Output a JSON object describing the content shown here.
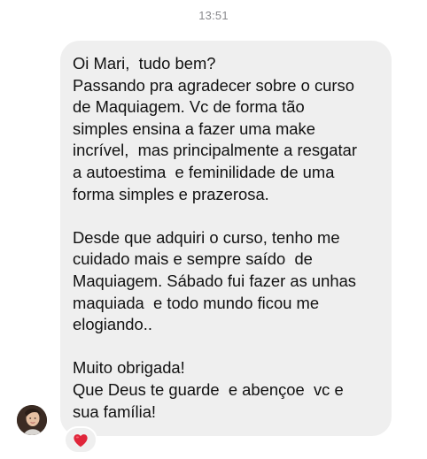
{
  "timestamp": "13:51",
  "message": {
    "paragraphs": [
      {
        "lines": [
          "Oi Mari,  tudo bem?",
          "Passando pra agradecer sobre o curso",
          "de Maquiagem. Vc de forma tão",
          "simples ensina a fazer uma make",
          "incrível,  mas principalmente a resgatar",
          "a autoestima  e feminilidade de uma",
          "forma simples e prazerosa."
        ]
      },
      {
        "lines": [
          "Desde que adquiri o curso, tenho me",
          "cuidado mais e sempre saído  de",
          "Maquiagem. Sábado fui fazer as unhas",
          "maquiada  e todo mundo ficou me",
          "elogiando.."
        ]
      },
      {
        "lines": [
          "Muito obrigada!",
          "Que Deus te guarde  e abençoe  vc e",
          "sua família!"
        ]
      }
    ]
  },
  "reaction": {
    "icon": "heart-icon",
    "color": "#e0253a"
  },
  "sender": {
    "avatar": "avatar"
  },
  "colors": {
    "bubble": "#efefef",
    "text": "#111111",
    "timestamp": "#8a8a8e"
  }
}
